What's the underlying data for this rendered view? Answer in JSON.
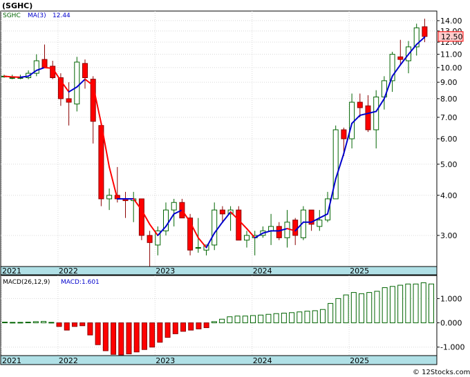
{
  "symbol_title": "(SGHC)",
  "price_legend": {
    "ticker": "SGHC",
    "ma_label": "MA(3)",
    "ma_value": "12.44"
  },
  "macd_legend": {
    "label": "MACD(26,12,9)",
    "value_label": "MACD:1.601"
  },
  "last_price_tag": "12.50",
  "credit": "© 12Stocks.com",
  "colors": {
    "up_candle": "#ffffff",
    "up_border": "#006400",
    "down_candle": "#ff0000",
    "down_border": "#8b0000",
    "ma_up": "#0000cc",
    "ma_down": "#ff0000",
    "axis_band": "#b0e0e6",
    "macd_bar_up": "#006400",
    "macd_bar_down": "#ff0000",
    "price_tag_bg": "#ffcccc"
  },
  "chart_data": [
    {
      "type": "candlestick",
      "title": "(SGHC)",
      "scale": "log",
      "ylim": [
        2.4,
        15.0
      ],
      "y_ticks": [
        "3.00",
        "4.00",
        "5.00",
        "6.00",
        "7.00",
        "8.00",
        "9.00",
        "10.00",
        "11.00",
        "12.00",
        "13.00",
        "14.00"
      ],
      "x_labels": [
        "2021",
        "2022",
        "2023",
        "2024",
        "2025"
      ],
      "candles": [
        [
          9.4,
          9.5,
          9.3,
          9.4
        ],
        [
          9.3,
          9.5,
          9.2,
          9.3
        ],
        [
          9.3,
          9.5,
          9.2,
          9.3
        ],
        [
          9.3,
          9.8,
          9.2,
          9.6
        ],
        [
          9.6,
          11.0,
          9.4,
          10.5
        ],
        [
          10.6,
          11.8,
          10.0,
          10.0
        ],
        [
          10.1,
          10.5,
          9.2,
          9.3
        ],
        [
          9.3,
          9.6,
          7.6,
          8.0
        ],
        [
          8.0,
          9.0,
          6.6,
          7.8
        ],
        [
          7.7,
          10.8,
          7.3,
          10.4
        ],
        [
          10.3,
          10.6,
          8.6,
          9.3
        ],
        [
          9.2,
          9.4,
          5.8,
          6.8
        ],
        [
          6.6,
          6.7,
          3.7,
          3.9
        ],
        [
          3.9,
          4.2,
          3.6,
          4.0
        ],
        [
          4.0,
          4.9,
          3.8,
          3.9
        ],
        [
          3.9,
          4.1,
          3.4,
          3.85
        ],
        [
          3.85,
          4.1,
          3.3,
          3.9
        ],
        [
          3.9,
          3.9,
          2.9,
          3.0
        ],
        [
          3.0,
          3.1,
          2.4,
          2.85
        ],
        [
          2.8,
          3.2,
          2.6,
          3.1
        ],
        [
          3.1,
          3.8,
          3.0,
          3.6
        ],
        [
          3.6,
          3.9,
          3.2,
          3.8
        ],
        [
          3.8,
          3.9,
          3.4,
          3.4
        ],
        [
          3.4,
          3.5,
          2.6,
          2.7
        ],
        [
          2.75,
          3.4,
          2.65,
          2.75
        ],
        [
          2.7,
          2.8,
          2.6,
          2.8
        ],
        [
          2.8,
          3.8,
          2.7,
          3.6
        ],
        [
          3.6,
          3.7,
          3.3,
          3.5
        ],
        [
          3.5,
          3.7,
          3.1,
          3.6
        ],
        [
          3.6,
          3.7,
          2.9,
          2.9
        ],
        [
          2.9,
          3.1,
          2.75,
          3.0
        ],
        [
          2.95,
          3.1,
          2.6,
          3.0
        ],
        [
          3.0,
          3.2,
          2.95,
          3.1
        ],
        [
          3.1,
          3.5,
          2.8,
          3.2
        ],
        [
          3.2,
          3.3,
          2.9,
          2.95
        ],
        [
          2.95,
          3.6,
          2.75,
          3.3
        ],
        [
          3.35,
          3.4,
          2.8,
          3.0
        ],
        [
          2.95,
          3.7,
          2.9,
          3.6
        ],
        [
          3.6,
          3.6,
          3.1,
          3.25
        ],
        [
          3.2,
          3.6,
          3.1,
          3.35
        ],
        [
          3.35,
          4.1,
          3.3,
          3.9
        ],
        [
          3.9,
          6.6,
          3.9,
          6.4
        ],
        [
          6.4,
          6.5,
          5.3,
          6.0
        ],
        [
          6.0,
          8.3,
          5.6,
          7.8
        ],
        [
          7.8,
          8.3,
          7.0,
          7.5
        ],
        [
          7.6,
          8.2,
          6.3,
          6.4
        ],
        [
          6.4,
          8.5,
          5.6,
          8.1
        ],
        [
          8.1,
          9.4,
          7.4,
          9.1
        ],
        [
          9.1,
          11.2,
          8.4,
          11.0
        ],
        [
          10.8,
          12.2,
          10.2,
          10.6
        ],
        [
          10.5,
          12.1,
          9.6,
          11.6
        ],
        [
          11.6,
          13.7,
          10.9,
          13.3
        ],
        [
          13.4,
          14.2,
          12.0,
          12.5
        ]
      ],
      "ma3": [
        9.4,
        9.35,
        9.33,
        9.4,
        9.8,
        10.0,
        9.95,
        9.1,
        8.4,
        8.7,
        9.2,
        8.8,
        6.7,
        4.9,
        3.9,
        3.9,
        3.9,
        3.6,
        3.25,
        3.0,
        3.2,
        3.5,
        3.6,
        3.3,
        2.95,
        2.75,
        3.05,
        3.3,
        3.55,
        3.35,
        3.15,
        2.95,
        3.05,
        3.1,
        3.1,
        3.15,
        3.1,
        3.3,
        3.3,
        3.4,
        3.5,
        4.5,
        5.4,
        6.7,
        7.1,
        7.2,
        7.3,
        8.0,
        9.4,
        10.2,
        11.0,
        11.8,
        12.44
      ],
      "last_price": 12.5
    },
    {
      "type": "bar",
      "title": "MACD(26,12,9)",
      "ylim": [
        -1.35,
        1.95
      ],
      "y_ticks": [
        "1.000",
        "0.000",
        "-1.000"
      ],
      "x_labels": [
        "2021",
        "2022",
        "2023",
        "2024",
        "2025"
      ],
      "values": [
        0.03,
        0.02,
        0.02,
        0.03,
        0.05,
        0.06,
        0.02,
        -0.15,
        -0.3,
        -0.15,
        -0.12,
        -0.5,
        -0.9,
        -1.15,
        -1.3,
        -1.32,
        -1.28,
        -1.2,
        -1.1,
        -1.0,
        -0.8,
        -0.6,
        -0.45,
        -0.35,
        -0.3,
        -0.25,
        -0.2,
        0.05,
        0.15,
        0.25,
        0.28,
        0.28,
        0.3,
        0.32,
        0.35,
        0.38,
        0.4,
        0.42,
        0.45,
        0.48,
        0.5,
        0.55,
        0.8,
        1.0,
        1.15,
        1.25,
        1.2,
        1.25,
        1.3,
        1.45,
        1.5,
        1.55,
        1.6,
        1.6,
        1.65,
        1.601
      ],
      "value": 1.601
    }
  ]
}
